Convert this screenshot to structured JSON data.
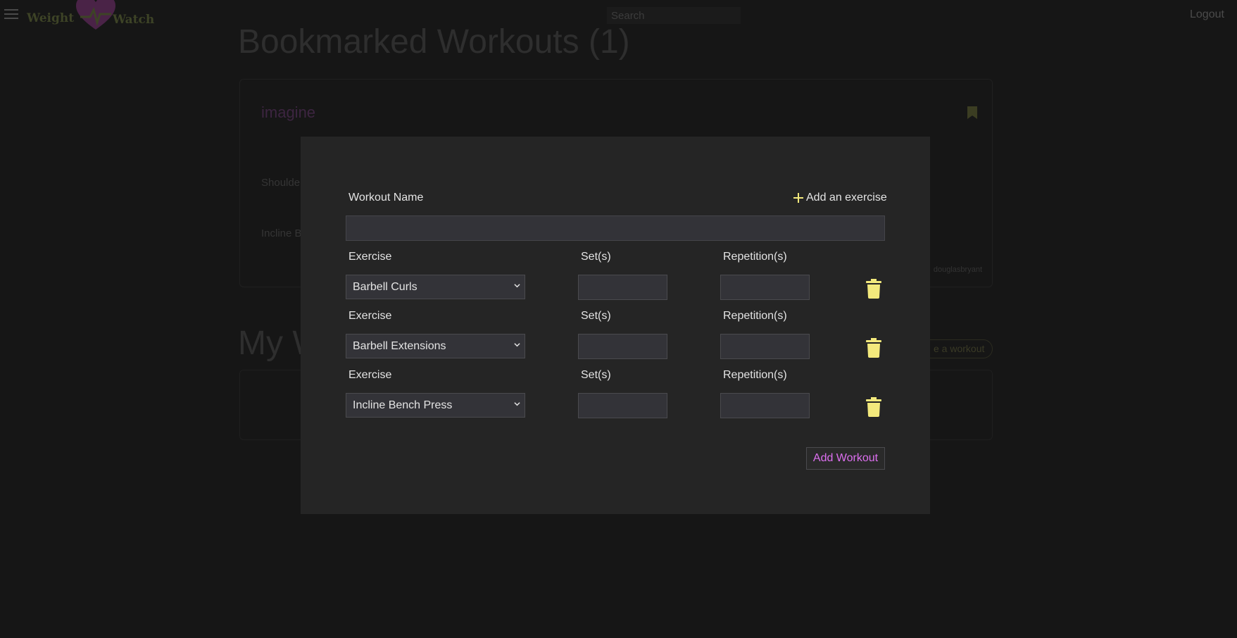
{
  "navbar": {
    "logo_word1": "Weight",
    "logo_word2": "Watch",
    "search_placeholder": "Search",
    "logout_label": "Logout"
  },
  "background": {
    "bookmarked_title": "Bookmarked Workouts (1)",
    "card": {
      "workout_name": "imagine",
      "exercise_1": "Shoulde",
      "exercise_2": "Incline B",
      "author": "douglasbryant"
    },
    "my_title": "My W",
    "create_label": "e a workout"
  },
  "modal": {
    "workout_name_label": "Workout Name",
    "add_exercise_label": "Add an exercise",
    "workout_name_value": "",
    "exercises": [
      {
        "exercise_label": "Exercise",
        "sets_label": "Set(s)",
        "reps_label": "Repetition(s)",
        "selected": "Barbell Curls",
        "sets": "",
        "reps": ""
      },
      {
        "exercise_label": "Exercise",
        "sets_label": "Set(s)",
        "reps_label": "Repetition(s)",
        "selected": "Barbell Extensions",
        "sets": "",
        "reps": ""
      },
      {
        "exercise_label": "Exercise",
        "sets_label": "Set(s)",
        "reps_label": "Repetition(s)",
        "selected": "Incline Bench Press",
        "sets": "",
        "reps": ""
      }
    ],
    "submit_label": "Add Workout"
  },
  "colors": {
    "modal_bg": "#252525",
    "accent_yellow": "#f3e97c",
    "accent_purple": "#dd6ff0",
    "page_bg": "#161616"
  },
  "icons": [
    "menu-icon",
    "heart-logo-icon",
    "bookmark-icon",
    "plus-icon",
    "chevron-down-icon",
    "trash-icon"
  ]
}
